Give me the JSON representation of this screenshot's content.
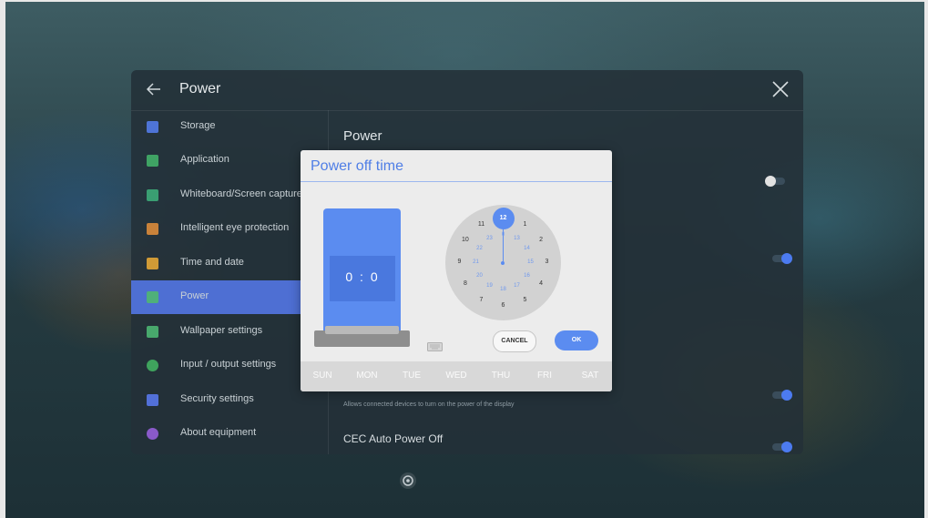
{
  "header": {
    "title": "Power"
  },
  "sidebar": {
    "items": [
      {
        "label": "Storage",
        "color": "#4e74d6"
      },
      {
        "label": "Application",
        "color": "#3fa364"
      },
      {
        "label": "Whiteboard/Screen capture",
        "color": "#3a9e72"
      },
      {
        "label": "Intelligent eye protection",
        "color": "#c9823a"
      },
      {
        "label": "Time and date",
        "color": "#d09a36"
      },
      {
        "label": "Power",
        "color": "#4fb07a",
        "active": true
      },
      {
        "label": "Wallpaper settings",
        "color": "#48a86c"
      },
      {
        "label": "Input / output settings",
        "color": "#3fa35d"
      },
      {
        "label": "Security settings",
        "color": "#5270d8"
      },
      {
        "label": "About equipment",
        "color": "#8a5ac9"
      }
    ]
  },
  "content": {
    "title": "Power",
    "description": "Allows connected devices to turn on the power of the display",
    "cec_title": "CEC Auto Power Off",
    "toggles": [
      {
        "state": "off"
      },
      {
        "state": "on"
      },
      {
        "state": "on"
      },
      {
        "state": "on"
      }
    ]
  },
  "dialog": {
    "title": "Power off time",
    "time": "0 : 0",
    "cancel_label": "CANCEL",
    "ok_label": "OK",
    "selected_hour": "12",
    "clock_outer": [
      "12",
      "1",
      "2",
      "3",
      "4",
      "5",
      "6",
      "7",
      "8",
      "9",
      "10",
      "11"
    ],
    "clock_inner": [
      "0",
      "13",
      "14",
      "15",
      "16",
      "17",
      "18",
      "19",
      "20",
      "21",
      "22",
      "23"
    ],
    "days": [
      "SUN",
      "MON",
      "TUE",
      "WED",
      "THU",
      "FRI",
      "SAT"
    ]
  },
  "colors": {
    "accent": "#5b8cf0",
    "sidebar_active": "#4e6fd3",
    "toggle_on": "#4c7bf0"
  },
  "icons": {
    "back": "back-arrow-icon",
    "close": "close-icon",
    "keyboard": "keyboard-icon",
    "settings": "gear-icon"
  }
}
